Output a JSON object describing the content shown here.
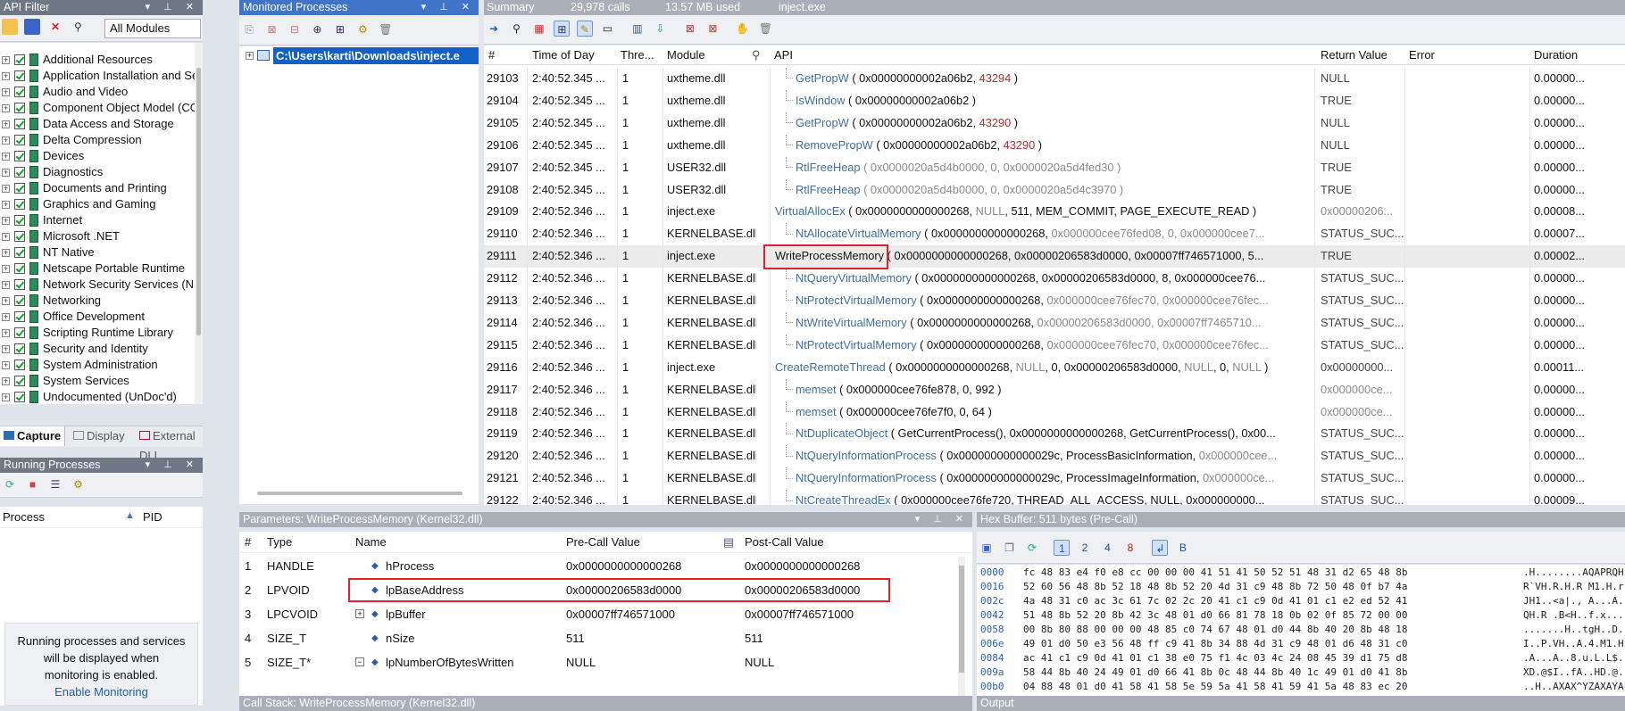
{
  "left_pane": {
    "title": "API Filter",
    "module_select": "All Modules",
    "categories": [
      "Additional Resources",
      "Application Installation and Se",
      "Audio and Video",
      "Component Object Model (CC",
      "Data Access and Storage",
      "Delta Compression",
      "Devices",
      "Diagnostics",
      "Documents and Printing",
      "Graphics and Gaming",
      "Internet",
      "Microsoft .NET",
      "NT Native",
      "Netscape Portable Runtime",
      "Network Security Services (NS",
      "Networking",
      "Office Development",
      "Scripting Runtime Library",
      "Security and Identity",
      "System Administration",
      "System Services",
      "Undocumented (UnDoc'd)"
    ],
    "tabs": [
      "Capture",
      "Display",
      "External DLL"
    ]
  },
  "running": {
    "title": "Running Processes",
    "col_process": "Process",
    "col_pid": "PID",
    "message": "Running processes and services will be displayed when monitoring is enabled.",
    "link": "Enable Monitoring"
  },
  "monitored": {
    "title": "Monitored Processes",
    "process_path": "C:\\Users\\karti\\Downloads\\inject.e"
  },
  "summary": {
    "tab": "Summary",
    "calls": "29,978 calls",
    "memory": "13.57 MB used",
    "process": "inject.exe"
  },
  "grid": {
    "headers": [
      "#",
      "Time of Day",
      "Thre...",
      "Module",
      "API",
      "Return Value",
      "Error",
      "Duration"
    ],
    "rows": [
      {
        "n": "29103",
        "t": "2:40:52.345 ...",
        "th": "1",
        "mod": "uxtheme.dll",
        "ind": true,
        "api": "GetPropW",
        "args": [
          [
            "( 0x00000000002a06b2, ",
            ""
          ],
          [
            "43294",
            "num"
          ],
          [
            " )",
            ""
          ]
        ],
        "ret": "NULL",
        "dur": "0.00000..."
      },
      {
        "n": "29104",
        "t": "2:40:52.345 ...",
        "th": "1",
        "mod": "uxtheme.dll",
        "ind": true,
        "api": "IsWindow",
        "args": [
          [
            "( 0x00000000002a06b2 )",
            ""
          ]
        ],
        "ret": "TRUE",
        "dur": "0.00000..."
      },
      {
        "n": "29105",
        "t": "2:40:52.345 ...",
        "th": "1",
        "mod": "uxtheme.dll",
        "ind": true,
        "api": "GetPropW",
        "args": [
          [
            "( 0x00000000002a06b2, ",
            ""
          ],
          [
            "43290",
            "num"
          ],
          [
            " )",
            ""
          ]
        ],
        "ret": "NULL",
        "dur": "0.00000..."
      },
      {
        "n": "29106",
        "t": "2:40:52.345 ...",
        "th": "1",
        "mod": "uxtheme.dll",
        "ind": true,
        "api": "RemovePropW",
        "args": [
          [
            "( 0x00000000002a06b2, ",
            ""
          ],
          [
            "43290",
            "num"
          ],
          [
            " )",
            ""
          ]
        ],
        "ret": "NULL",
        "dur": "0.00000..."
      },
      {
        "n": "29107",
        "t": "2:40:52.345 ...",
        "th": "1",
        "mod": "USER32.dll",
        "ind": true,
        "api": "RtlFreeHeap",
        "args": [
          [
            "( 0x0000020a5d4b0000, 0, 0x0000020a5d4fed30 )",
            "dim"
          ]
        ],
        "ret": "TRUE",
        "dur": "0.00000..."
      },
      {
        "n": "29108",
        "t": "2:40:52.345 ...",
        "th": "1",
        "mod": "USER32.dll",
        "ind": true,
        "api": "RtlFreeHeap",
        "args": [
          [
            "( 0x0000020a5d4b0000, 0, 0x0000020a5d4c3970 )",
            "dim"
          ]
        ],
        "ret": "TRUE",
        "dur": "0.00000..."
      },
      {
        "n": "29109",
        "t": "2:40:52.346 ...",
        "th": "1",
        "mod": "inject.exe",
        "ind": false,
        "api": "VirtualAllocEx",
        "args": [
          [
            "( 0x0000000000000268, ",
            ""
          ],
          [
            "NULL",
            "dim"
          ],
          [
            ", 511, MEM_COMMIT, PAGE_EXECUTE_READ )",
            ""
          ]
        ],
        "ret": "0x00000206...",
        "retdim": true,
        "dur": "0.00008..."
      },
      {
        "n": "29110",
        "t": "2:40:52.346 ...",
        "th": "1",
        "mod": "KERNELBASE.dll",
        "ind": true,
        "api": "NtAllocateVirtualMemory",
        "args": [
          [
            "( 0x0000000000000268, ",
            ""
          ],
          [
            "0x000000cee76fed08, 0, 0x000000cee7...",
            "dim"
          ]
        ],
        "ret": "STATUS_SUC...",
        "dur": "0.00007..."
      },
      {
        "n": "29111",
        "t": "2:40:52.346 ...",
        "th": "1",
        "mod": "inject.exe",
        "ind": false,
        "sel": true,
        "api": "WriteProcessMemory",
        "args": [
          [
            "( 0x0000000000000268, 0x00000206583d0000, 0x00007ff746571000, 5...",
            ""
          ]
        ],
        "ret": "TRUE",
        "dur": "0.00002..."
      },
      {
        "n": "29112",
        "t": "2:40:52.346 ...",
        "th": "1",
        "mod": "KERNELBASE.dll",
        "ind": true,
        "api": "NtQueryVirtualMemory",
        "args": [
          [
            "( 0x0000000000000268, 0x00000206583d0000, 8, 0x000000cee76...",
            ""
          ]
        ],
        "ret": "STATUS_SUC...",
        "dur": "0.00000..."
      },
      {
        "n": "29113",
        "t": "2:40:52.346 ...",
        "th": "1",
        "mod": "KERNELBASE.dll",
        "ind": true,
        "api": "NtProtectVirtualMemory",
        "args": [
          [
            "( 0x0000000000000268, ",
            ""
          ],
          [
            "0x000000cee76fec70, 0x000000cee76fec...",
            "dim"
          ]
        ],
        "ret": "STATUS_SUC...",
        "dur": "0.00000..."
      },
      {
        "n": "29114",
        "t": "2:40:52.346 ...",
        "th": "1",
        "mod": "KERNELBASE.dll",
        "ind": true,
        "api": "NtWriteVirtualMemory",
        "args": [
          [
            "( 0x0000000000000268, ",
            ""
          ],
          [
            "0x00000206583d0000, 0x00007ff7465710...",
            "dim"
          ]
        ],
        "ret": "STATUS_SUC...",
        "dur": "0.00000..."
      },
      {
        "n": "29115",
        "t": "2:40:52.346 ...",
        "th": "1",
        "mod": "KERNELBASE.dll",
        "ind": true,
        "api": "NtProtectVirtualMemory",
        "args": [
          [
            "( 0x0000000000000268, ",
            ""
          ],
          [
            "0x000000cee76fec70, 0x000000cee76fec...",
            "dim"
          ]
        ],
        "ret": "STATUS_SUC...",
        "dur": "0.00000..."
      },
      {
        "n": "29116",
        "t": "2:40:52.346 ...",
        "th": "1",
        "mod": "inject.exe",
        "ind": false,
        "api": "CreateRemoteThread",
        "args": [
          [
            "( 0x0000000000000268, ",
            ""
          ],
          [
            "NULL",
            "dim"
          ],
          [
            ", 0, 0x00000206583d0000, ",
            ""
          ],
          [
            "NULL",
            "dim"
          ],
          [
            ", 0, ",
            ""
          ],
          [
            "NULL",
            "dim"
          ],
          [
            " )",
            ""
          ]
        ],
        "ret": "0x00000000...",
        "dur": "0.00011..."
      },
      {
        "n": "29117",
        "t": "2:40:52.346 ...",
        "th": "1",
        "mod": "KERNELBASE.dll",
        "ind": true,
        "api": "memset",
        "args": [
          [
            "( 0x000000cee76fe878, 0, 992 )",
            ""
          ]
        ],
        "ret": "0x000000ce...",
        "retdim": true,
        "dur": "0.00000..."
      },
      {
        "n": "29118",
        "t": "2:40:52.346 ...",
        "th": "1",
        "mod": "KERNELBASE.dll",
        "ind": true,
        "api": "memset",
        "args": [
          [
            "( 0x000000cee76fe7f0, 0, 64 )",
            ""
          ]
        ],
        "ret": "0x000000ce...",
        "retdim": true,
        "dur": "0.00000..."
      },
      {
        "n": "29119",
        "t": "2:40:52.346 ...",
        "th": "1",
        "mod": "KERNELBASE.dll",
        "ind": true,
        "api": "NtDuplicateObject",
        "args": [
          [
            "( GetCurrentProcess(), 0x0000000000000268, GetCurrentProcess(), 0x00...",
            ""
          ]
        ],
        "ret": "STATUS_SUC...",
        "dur": "0.00000..."
      },
      {
        "n": "29120",
        "t": "2:40:52.346 ...",
        "th": "1",
        "mod": "KERNELBASE.dll",
        "ind": true,
        "api": "NtQueryInformationProcess",
        "args": [
          [
            "( 0x000000000000029c, ProcessBasicInformation, ",
            ""
          ],
          [
            "0x000000cee...",
            "dim"
          ]
        ],
        "ret": "STATUS_SUC...",
        "dur": "0.00000..."
      },
      {
        "n": "29121",
        "t": "2:40:52.346 ...",
        "th": "1",
        "mod": "KERNELBASE.dll",
        "ind": true,
        "api": "NtQueryInformationProcess",
        "args": [
          [
            "( 0x000000000000029c, ProcessImageInformation, ",
            ""
          ],
          [
            "0x000000ce...",
            "dim"
          ]
        ],
        "ret": "STATUS_SUC...",
        "dur": "0.00000..."
      },
      {
        "n": "29122",
        "t": "2:40:52.346 ...",
        "th": "1",
        "mod": "KERNELBASE.dll",
        "ind": true,
        "api": "NtCreateThreadEx",
        "args": [
          [
            "( 0x000000cee76fe720, THREAD_ALL_ACCESS, NULL, 0x000000000...",
            ""
          ]
        ],
        "ret": "STATUS_SUC...",
        "dur": "0.00009..."
      }
    ]
  },
  "params": {
    "title": "Parameters: WriteProcessMemory (Kernel32.dll)",
    "headers": [
      "#",
      "Type",
      "Name",
      "Pre-Call Value",
      "Post-Call Value"
    ],
    "rows": [
      {
        "n": "1",
        "type": "HANDLE",
        "name": "hProcess",
        "pre": "0x0000000000000268",
        "post": "0x0000000000000268",
        "exp": ""
      },
      {
        "n": "2",
        "type": "LPVOID",
        "name": "lpBaseAddress",
        "pre": "0x00000206583d0000",
        "post": "0x00000206583d0000",
        "exp": ""
      },
      {
        "n": "3",
        "type": "LPCVOID",
        "name": "lpBuffer",
        "pre": "0x00007ff746571000",
        "post": "0x00007ff746571000",
        "exp": "+"
      },
      {
        "n": "4",
        "type": "SIZE_T",
        "name": "nSize",
        "pre": "511",
        "post": "511",
        "exp": ""
      },
      {
        "n": "5",
        "type": "SIZE_T*",
        "name": "lpNumberOfBytesWritten",
        "pre": "NULL",
        "post": "NULL",
        "exp": "-"
      }
    ]
  },
  "hex": {
    "title": "Hex Buffer: 511 bytes (Pre-Call)",
    "rows": [
      {
        "off": "0000",
        "bytes": "fc 48 83 e4 f0 e8 cc 00 00 00 41 51 41 50 52 51 48 31 d2 65 48 8b",
        "ascii": ".H........AQAPRQH"
      },
      {
        "off": "0016",
        "bytes": "52 60 56 48 8b 52 18 48 8b 52 20 4d 31 c9 48 8b 72 50 48 0f b7 4a",
        "ascii": "R`VH.R.H.R M1.H.r"
      },
      {
        "off": "002c",
        "bytes": "4a 48 31 c0 ac 3c 61 7c 02 2c 20 41 c1 c9 0d 41 01 c1 e2 ed 52 41",
        "ascii": "JH1..<a|., A...A."
      },
      {
        "off": "0042",
        "bytes": "51 48 8b 52 20 8b 42 3c 48 01 d0 66 81 78 18 0b 02 0f 85 72 00 00",
        "ascii": "QH.R .B<H..f.x..."
      },
      {
        "off": "0058",
        "bytes": "00 8b 80 88 00 00 00 48 85 c0 74 67 48 01 d0 44 8b 40 20 8b 48 18",
        "ascii": ".......H..tgH..D."
      },
      {
        "off": "006e",
        "bytes": "49 01 d0 50 e3 56 48 ff c9 41 8b 34 88 4d 31 c9 48 01 d6 48 31 c0",
        "ascii": "I..P.VH..A.4.M1.H"
      },
      {
        "off": "0084",
        "bytes": "ac 41 c1 c9 0d 41 01 c1 38 e0 75 f1 4c 03 4c 24 08 45 39 d1 75 d8",
        "ascii": ".A...A..8.u.L.L$."
      },
      {
        "off": "009a",
        "bytes": "58 44 8b 40 24 49 01 d0 66 41 8b 0c 48 44 8b 40 1c 49 01 d0 41 8b",
        "ascii": "XD.@$I..fA..HD.@."
      },
      {
        "off": "00b0",
        "bytes": "04 88 48 01 d0 41 58 41 58 5e 59 5a 41 58 41 59 41 5a 48 83 ec 20",
        "ascii": "..H..AXAX^YZAXAYA"
      }
    ]
  },
  "bottom": {
    "call_stack": "Call Stack: WriteProcessMemory (Kernel32.dll)",
    "output": "Output"
  },
  "colors": {
    "header_bg": "#6e7785",
    "selected_path_bg": "#1060c8",
    "highlight_red": "#e0202a",
    "api_link": "#3f6f9f"
  }
}
